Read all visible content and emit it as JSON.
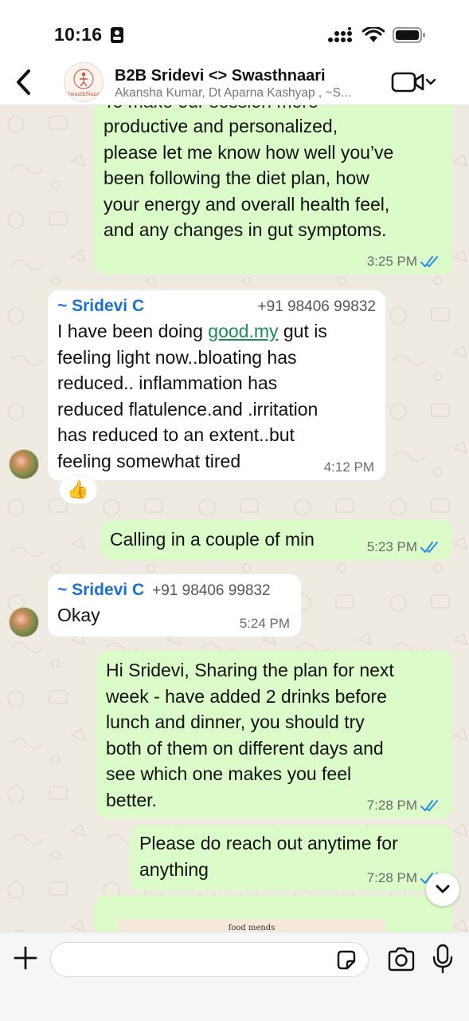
{
  "status_bar": {
    "time": "10:16",
    "icons": [
      "id-card-icon",
      "cellular-signal-icon",
      "wifi-icon",
      "battery-icon"
    ]
  },
  "header": {
    "avatar_text": "SwasthNaari",
    "title": "B2B Sridevi <> Swasthnaari",
    "subtitle": "Akansha Kumar, Dt Aparna Kashyap , ~S...",
    "icons": [
      "back-chevron-icon",
      "video-call-icon",
      "chevron-down-icon"
    ]
  },
  "messages": [
    {
      "direction": "outgoing",
      "text_clipped": "To make our session more",
      "text": "productive and personalized,\nplease let me know how well you’ve\nbeen following the diet plan, how\nyour energy and overall health feel,\nand any changes in gut symptoms.",
      "time": "3:25 PM",
      "status": "read"
    },
    {
      "direction": "incoming",
      "sender": "~ Sridevi C",
      "phone": "+91 98406 99832",
      "text_before_link": "I have been doing ",
      "link": "good.my",
      "text_after_link": " gut is\nfeeling light now..bloating has\nreduced.. inflammation has\nreduced  flatulence.and .irritation\nhas reduced to an extent..but\nfeeling somewhat tired",
      "time": "4:12 PM",
      "reaction": "👍"
    },
    {
      "direction": "outgoing",
      "text": "Calling in a couple of min",
      "time": "5:23 PM",
      "status": "read"
    },
    {
      "direction": "incoming",
      "sender": "~ Sridevi C",
      "phone": "+91 98406 99832",
      "text": "Okay",
      "time": "5:24 PM"
    },
    {
      "direction": "outgoing",
      "text": "Hi Sridevi, Sharing the plan for next\nweek - have added 2 drinks before\nlunch and dinner, you should try\nboth of them on different days and\nsee which one makes you feel\nbetter.",
      "time": "7:28 PM",
      "status": "read"
    },
    {
      "direction": "outgoing",
      "text": "Please do reach out anytime for\nanything",
      "time": "7:28 PM",
      "status": "read"
    },
    {
      "direction": "outgoing",
      "type": "document-preview",
      "preview_text": "food  mends"
    }
  ],
  "composer": {
    "placeholder": "",
    "icons": [
      "plus-icon",
      "sticker-icon",
      "camera-icon",
      "microphone-icon"
    ]
  },
  "colors": {
    "outgoing_bubble": "#dbfcc8",
    "incoming_bubble": "#ffffff",
    "chat_background": "#f0ebe2",
    "sender_name": "#1c6fd0",
    "read_ticks": "#2c8cf0",
    "link": "#1e8a54"
  }
}
